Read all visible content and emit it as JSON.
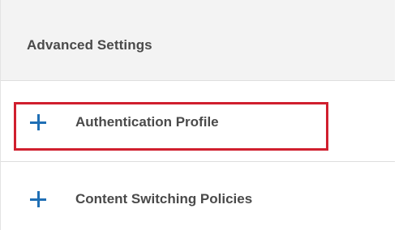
{
  "section": {
    "title": "Advanced Settings"
  },
  "items": [
    {
      "label": "Authentication Profile",
      "icon": "plus-icon"
    },
    {
      "label": "Content Switching Policies",
      "icon": "plus-icon"
    }
  ],
  "colors": {
    "accent": "#1f6fb5",
    "highlight": "#d01f2e",
    "header_bg": "#f3f3f3",
    "text": "#4a4a4a"
  }
}
